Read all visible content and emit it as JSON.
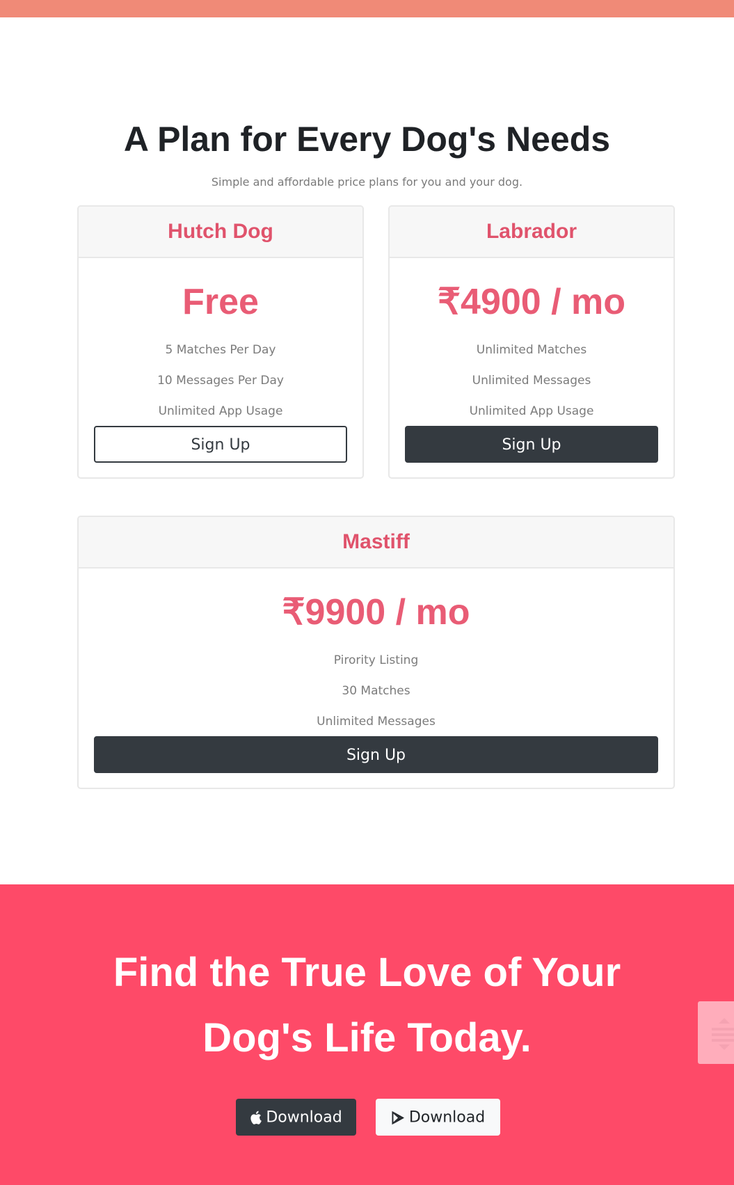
{
  "pricing": {
    "heading": "A Plan for Every Dog's Needs",
    "subheading": "Simple and affordable price plans for you and your dog.",
    "plans": [
      {
        "name": "Hutch Dog",
        "price": "Free",
        "features": [
          "5 Matches Per Day",
          "10 Messages Per Day",
          "Unlimited App Usage"
        ],
        "button_label": "Sign Up",
        "button_style": "outline"
      },
      {
        "name": "Labrador",
        "price": "₹4900 / mo",
        "features": [
          "Unlimited Matches",
          "Unlimited Messages",
          "Unlimited App Usage"
        ],
        "button_label": "Sign Up",
        "button_style": "dark"
      },
      {
        "name": "Mastiff",
        "price": "₹9900 / mo",
        "features": [
          "Pirority Listing",
          "30 Matches",
          "Unlimited Messages"
        ],
        "button_label": "Sign Up",
        "button_style": "dark"
      }
    ]
  },
  "cta": {
    "title_line1": "Find the True Love of Your",
    "title_line2": "Dog's Life Today.",
    "apple_button": {
      "label": "Download",
      "icon": "apple-icon"
    },
    "play_button": {
      "label": "Download",
      "icon": "google-play-icon"
    }
  },
  "scroll_widget": {
    "up_icon": "arrow-up-icon",
    "down_icon": "arrow-down-icon"
  },
  "colors": {
    "top_strip": "#f08a77",
    "accent": "#e95c75",
    "cta_background": "#fe4a68",
    "dark_button": "#343a40"
  }
}
